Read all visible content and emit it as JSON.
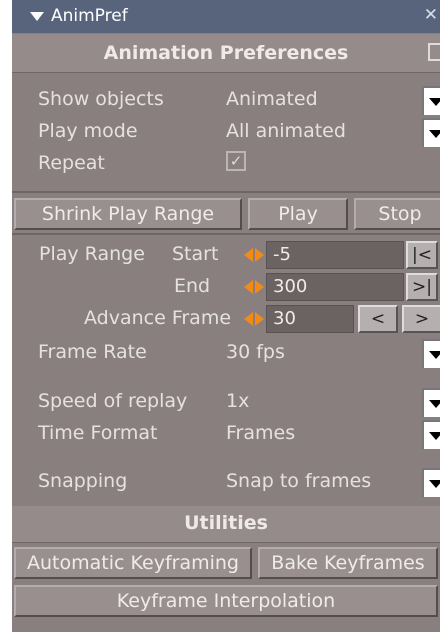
{
  "window": {
    "title": "AnimPref",
    "close_glyph": "✕"
  },
  "sections": {
    "animation_preferences": "Animation Preferences",
    "utilities": "Utilities"
  },
  "settings": {
    "show_objects": {
      "label": "Show objects",
      "value": "Animated"
    },
    "play_mode": {
      "label": "Play mode",
      "value": "All animated"
    },
    "repeat": {
      "label": "Repeat",
      "checked": true
    },
    "frame_rate": {
      "label": "Frame Rate",
      "value": "30 fps"
    },
    "speed_of_replay": {
      "label": "Speed of replay",
      "value": "1x"
    },
    "time_format": {
      "label": "Time Format",
      "value": "Frames"
    },
    "snapping": {
      "label": "Snapping",
      "value": "Snap to frames"
    }
  },
  "playback_buttons": {
    "shrink": "Shrink Play Range",
    "play": "Play",
    "stop": "Stop"
  },
  "play_range": {
    "label": "Play Range",
    "start_label": "Start",
    "start_value": "-5",
    "end_label": "End",
    "end_value": "300",
    "advance_label": "Advance Frame",
    "advance_value": "30",
    "go_start": "|<",
    "go_end": ">|",
    "step_back": "<",
    "step_forward": ">"
  },
  "utilities_buttons": {
    "auto_keyframing": "Automatic Keyframing",
    "bake_keyframes": "Bake Keyframes",
    "keyframe_interpolation": "Keyframe Interpolation"
  },
  "colors": {
    "panel_bg": "#8a7f7f",
    "title_bar": "#57647c",
    "keyframe_icon": "#f08a18",
    "field_bg": "#6b6262"
  },
  "icons": [
    "collapse-triangle-icon",
    "close-icon",
    "toggle-box-icon",
    "dropdown-arrow-icon",
    "checkmark-icon",
    "keyframe-diamond-icon"
  ]
}
